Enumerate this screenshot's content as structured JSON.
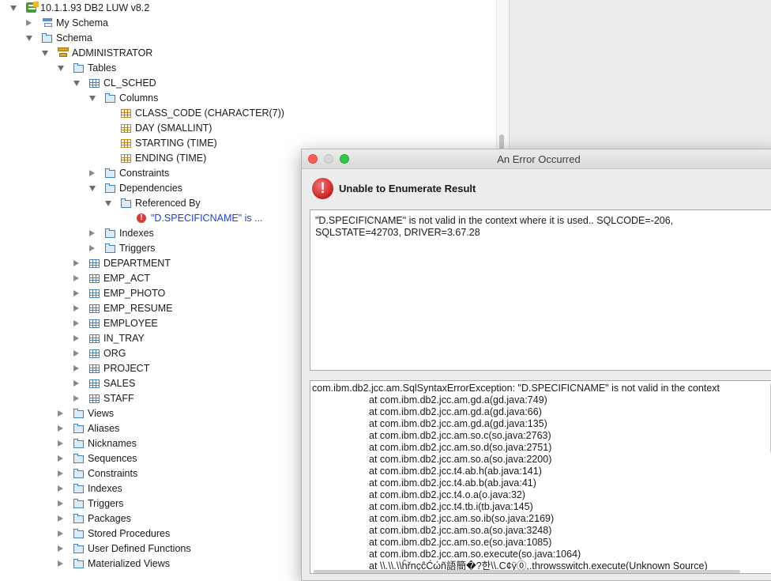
{
  "tree": {
    "rows": [
      {
        "label": "10.1.1.93 DB2 LUW v8.2",
        "icon": "server-icon"
      },
      {
        "label": "My Schema",
        "icon": "schema-icon"
      },
      {
        "label": "Schema",
        "icon": "folder-icon"
      },
      {
        "label": "ADMINISTRATOR",
        "icon": "user-schema-icon"
      },
      {
        "label": "Tables",
        "icon": "folder-icon"
      },
      {
        "label": "CL_SCHED",
        "icon": "table-icon"
      },
      {
        "label": "Columns",
        "icon": "folder-icon"
      },
      {
        "label": "CLASS_CODE (CHARACTER(7))",
        "icon": "column-icon"
      },
      {
        "label": "DAY (SMALLINT)",
        "icon": "column-icon"
      },
      {
        "label": "STARTING (TIME)",
        "icon": "column-icon"
      },
      {
        "label": "ENDING (TIME)",
        "icon": "column-icon"
      },
      {
        "label": "Constraints",
        "icon": "folder-icon"
      },
      {
        "label": "Dependencies",
        "icon": "folder-icon"
      },
      {
        "label": "Referenced By",
        "icon": "folder-icon"
      },
      {
        "label": "\"D.SPECIFICNAME\" is ...",
        "icon": "error-icon"
      },
      {
        "label": "Indexes",
        "icon": "folder-icon"
      },
      {
        "label": "Triggers",
        "icon": "folder-icon"
      },
      {
        "label": "DEPARTMENT",
        "icon": "table-icon"
      },
      {
        "label": "EMP_ACT",
        "icon": "table-icon"
      },
      {
        "label": "EMP_PHOTO",
        "icon": "table-icon"
      },
      {
        "label": "EMP_RESUME",
        "icon": "table-icon"
      },
      {
        "label": "EMPLOYEE",
        "icon": "table-icon"
      },
      {
        "label": "IN_TRAY",
        "icon": "table-icon"
      },
      {
        "label": "ORG",
        "icon": "table-icon"
      },
      {
        "label": "PROJECT",
        "icon": "table-icon"
      },
      {
        "label": "SALES",
        "icon": "table-icon"
      },
      {
        "label": "STAFF",
        "icon": "table-icon"
      },
      {
        "label": "Views",
        "icon": "folder-icon"
      },
      {
        "label": "Aliases",
        "icon": "folder-icon"
      },
      {
        "label": "Nicknames",
        "icon": "folder-icon"
      },
      {
        "label": "Sequences",
        "icon": "folder-icon"
      },
      {
        "label": "Constraints",
        "icon": "folder-icon"
      },
      {
        "label": "Indexes",
        "icon": "folder-icon"
      },
      {
        "label": "Triggers",
        "icon": "folder-icon"
      },
      {
        "label": "Packages",
        "icon": "folder-icon"
      },
      {
        "label": "Stored Procedures",
        "icon": "folder-icon"
      },
      {
        "label": "User Defined Functions",
        "icon": "folder-icon"
      },
      {
        "label": "Materialized Views",
        "icon": "folder-icon"
      }
    ]
  },
  "dialog": {
    "title": "An Error Occurred",
    "heading": "Unable to Enumerate Result",
    "message": "\"D.SPECIFICNAME\" is not valid in the context where it is used.. SQLCODE=-206,\nSQLSTATE=42703, DRIVER=3.67.28",
    "trace": [
      "com.ibm.db2.jcc.am.SqlSyntaxErrorException: \"D.SPECIFICNAME\" is not valid in the context",
      "at com.ibm.db2.jcc.am.gd.a(gd.java:749)",
      "at com.ibm.db2.jcc.am.gd.a(gd.java:66)",
      "at com.ibm.db2.jcc.am.gd.a(gd.java:135)",
      "at com.ibm.db2.jcc.am.so.c(so.java:2763)",
      "at com.ibm.db2.jcc.am.so.d(so.java:2751)",
      "at com.ibm.db2.jcc.am.so.a(so.java:2200)",
      "at com.ibm.db2.jcc.t4.ab.h(ab.java:141)",
      "at com.ibm.db2.jcc.t4.ab.b(ab.java:41)",
      "at com.ibm.db2.jcc.t4.o.a(o.java:32)",
      "at com.ibm.db2.jcc.t4.tb.i(tb.java:145)",
      "at com.ibm.db2.jcc.am.so.ib(so.java:2169)",
      "at com.ibm.db2.jcc.am.so.a(so.java:3248)",
      "at com.ibm.db2.jcc.am.so.e(so.java:1085)",
      "at com.ibm.db2.jcc.am.so.execute(so.java:1064)",
      "at \\\\.\\\\.\\\\ĥřnçĉĆώñ語簡�?한\\\\.C¢ÿ⓪,.throwsswitch.execute(Unknown Source)"
    ]
  },
  "colors": {
    "error_red": "#d73b3b",
    "link_blue": "#1a3fd6",
    "folder_blue": "#3f7fc4"
  }
}
